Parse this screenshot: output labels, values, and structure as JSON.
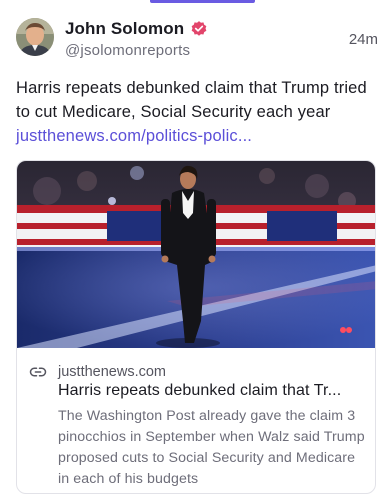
{
  "post": {
    "author_name": "John Solomon",
    "author_handle": "@jsolomonreports",
    "timestamp": "24m",
    "text": "Harris repeats debunked claim that Trump tried to cut Medicare, Social Security each year",
    "link_text": "justthenews.com/politics-polic...",
    "verified_icon": "verified-badge-icon"
  },
  "link_card": {
    "domain": "justthenews.com",
    "title": "Harris repeats debunked claim that Tr...",
    "description": "The Washington Post already gave the claim 3 pinocchios in September when Walz said Trump proposed cuts to Social Security and Medicare in each of his budgets",
    "icon": "link-icon"
  },
  "colors": {
    "accent": "#6a5be2",
    "link": "#5b4fd8",
    "verified": "#e2456b",
    "muted_text": "#6e6e7a"
  }
}
